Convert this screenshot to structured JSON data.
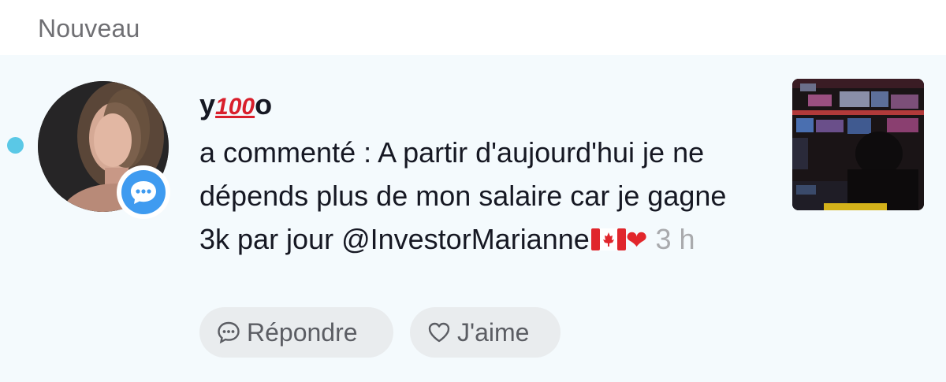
{
  "section": {
    "title": "Nouveau"
  },
  "notification": {
    "username_prefix": "y",
    "username_emoji": "100",
    "username_suffix": "o",
    "comment": "a commenté : A partir d'aujourd'hui je ne dépends plus de mon salaire car je gagne 3k par jour @InvestorMarianne",
    "time": "3 h",
    "reply_label": "Répondre",
    "like_label": "J'aime"
  },
  "colors": {
    "unread_dot": "#5ac8e6",
    "badge_blue": "#3f9bf0",
    "heart_red": "#e2262b",
    "notification_bg": "#f4fafd"
  },
  "icons": [
    "comment-bubble-icon",
    "reply-bubble-icon",
    "heart-outline-icon",
    "canada-flag-icon",
    "red-heart-icon"
  ]
}
